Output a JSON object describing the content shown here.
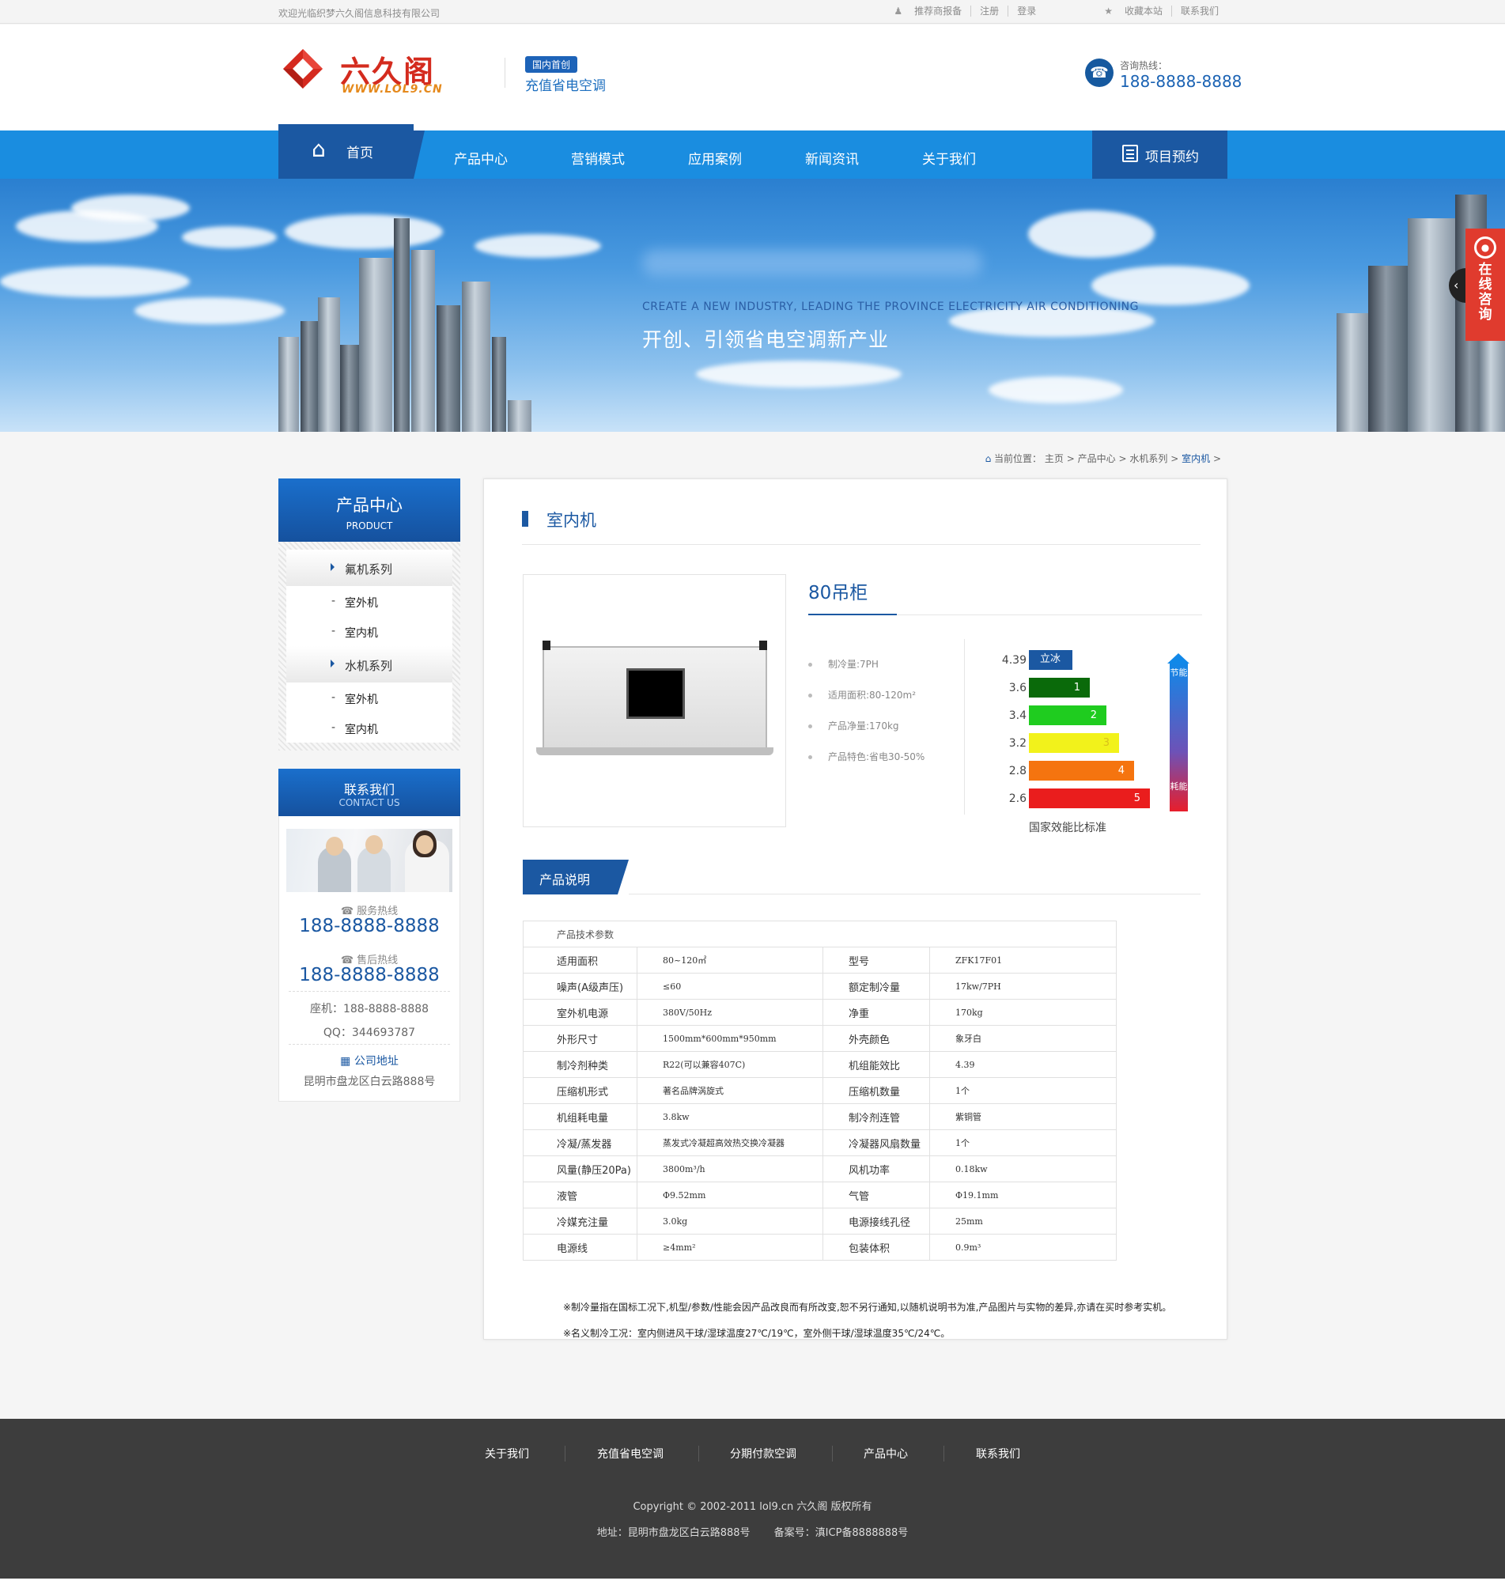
{
  "topbar": {
    "welcome": "欢迎光临织梦六久阁信息科技有限公司",
    "recommend": "推荐商报备",
    "register": "注册",
    "login": "登录",
    "favorite": "收藏本站",
    "contact": "联系我们"
  },
  "header": {
    "logo_name": "六久阁",
    "logo_url": "WWW.LOL9.CN",
    "badge": "国内首创",
    "slogan": "充值省电空调",
    "hotline_label": "咨询热线：",
    "hotline_number": "188-8888-8888"
  },
  "nav": {
    "home": "首页",
    "items": [
      "产品中心",
      "营销模式",
      "应用案例",
      "新闻资讯",
      "关于我们"
    ],
    "booking": "项目预约"
  },
  "banner": {
    "en": "CREATE A NEW INDUSTRY, LEADING THE PROVINCE ELECTRICITY AIR CONDITIONING",
    "cn": "开创、引领省电空调新产业"
  },
  "consult": {
    "text": "在线咨询"
  },
  "breadcrumb": {
    "prefix": "当前位置：",
    "items": [
      "主页",
      "产品中心",
      "水机系列"
    ],
    "current": "室内机",
    "sep": ">"
  },
  "sidebar": {
    "title": "产品中心",
    "subtitle": "PRODUCT",
    "categories": [
      {
        "label": "氟机系列",
        "subs": [
          "室外机",
          "室内机"
        ]
      },
      {
        "label": "水机系列",
        "subs": [
          "室外机",
          "室内机"
        ]
      }
    ],
    "dash": "-"
  },
  "contact": {
    "title": "联系我们",
    "subtitle": "CONTACT US",
    "service_label": "服务热线",
    "service_number": "188-8888-8888",
    "aftersale_label": "售后热线",
    "aftersale_number": "188-8888-8888",
    "landline": "座机：188-8888-8888",
    "qq": "QQ：344693787",
    "address_label": "公司地址",
    "address": "昆明市盘龙区白云路888号"
  },
  "main": {
    "title": "室内机",
    "product_name": "80吊柜",
    "specs": [
      "制冷量:7PH",
      "适用面积:80-120m²",
      "产品净量:170kg",
      "产品特色:省电30-50%"
    ],
    "efficiency": {
      "levels": [
        {
          "value": "4.39",
          "label": "立冰",
          "color": "#1b58a2",
          "width": 55
        },
        {
          "value": "3.6",
          "label": "1",
          "color": "#0a6a0a",
          "width": 77
        },
        {
          "value": "3.4",
          "label": "2",
          "color": "#1fcc1f",
          "width": 98
        },
        {
          "value": "3.2",
          "label": "3",
          "color": "#f2f21b",
          "width": 114
        },
        {
          "value": "2.8",
          "label": "4",
          "color": "#f5740f",
          "width": 133
        },
        {
          "value": "2.6",
          "label": "5",
          "color": "#ea1d1d",
          "width": 153
        }
      ],
      "note": "国家效能比标准",
      "top_word": "节能",
      "bottom_word": "耗能"
    },
    "desc_tab": "产品说明",
    "table_caption": "产品技术参数",
    "table_rows": [
      [
        "适用面积",
        "80~120㎡",
        "型号",
        "ZFK17F01"
      ],
      [
        "噪声(A级声压)",
        "≤60",
        "额定制冷量",
        "17kw/7PH"
      ],
      [
        "室外机电源",
        "380V/50Hz",
        "净重",
        "170kg"
      ],
      [
        "外形尺寸",
        "1500mm*600mm*950mm",
        "外壳颜色",
        "象牙白"
      ],
      [
        "制冷剂种类",
        "R22(可以兼容407C)",
        "机组能效比",
        "4.39"
      ],
      [
        "压缩机形式",
        "著名品牌涡旋式",
        "压缩机数量",
        "1个"
      ],
      [
        "机组耗电量",
        "3.8kw",
        "制冷剂连管",
        "紫铜管"
      ],
      [
        "冷凝/蒸发器",
        "蒸发式冷凝超高效热交换冷凝器",
        "冷凝器风扇数量",
        "1个"
      ],
      [
        "风量(静压20Pa)",
        "3800m³/h",
        "风机功率",
        "0.18kw"
      ],
      [
        "液管",
        "Φ9.52mm",
        "气管",
        "Φ19.1mm"
      ],
      [
        "冷媒充注量",
        "3.0kg",
        "电源接线孔径",
        "25mm"
      ],
      [
        "电源线",
        "≥4mm²",
        "包装体积",
        "0.9m³"
      ]
    ],
    "notes": [
      "※制冷量指在国标工况下,机型/参数/性能会因产品改良而有所改变,恕不另行通知,以随机说明书为准,产品图片与实物的差异,亦请在买时参考实机。",
      "※名义制冷工况：室内侧进风干球/湿球温度27℃/19℃，室外侧干球/湿球温度35℃/24℃。"
    ]
  },
  "footer": {
    "links": [
      "关于我们",
      "充值省电空调",
      "分期付款空调",
      "产品中心",
      "联系我们"
    ],
    "copyright": "Copyright © 2002-2011 lol9.cn 六久阁 版权所有",
    "address": "地址：昆明市盘龙区白云路888号",
    "icp": "备案号：滇ICP备8888888号"
  }
}
